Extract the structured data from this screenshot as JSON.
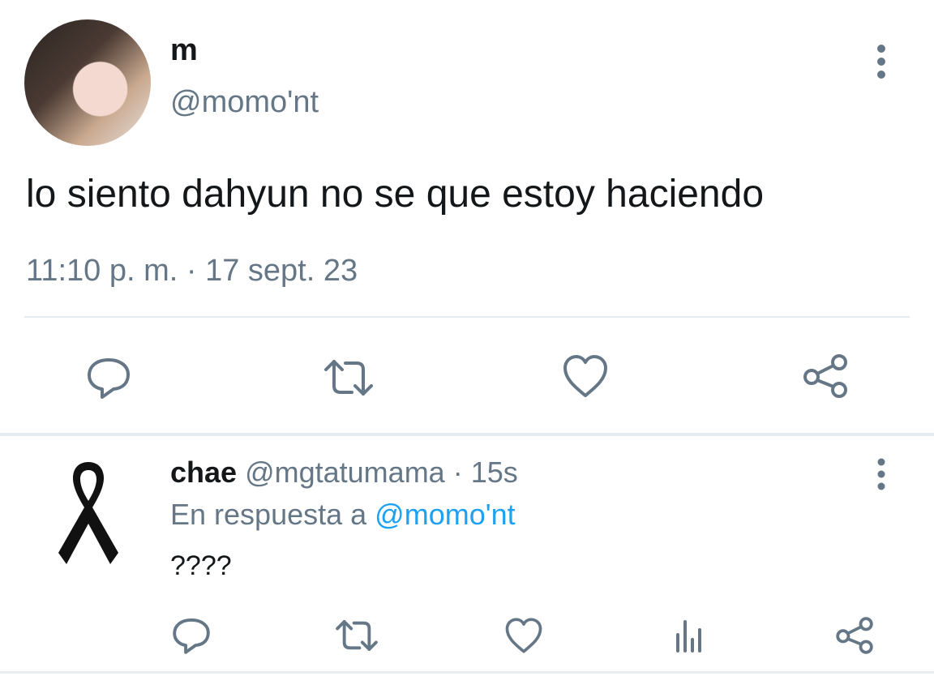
{
  "tweet": {
    "author_name": "m",
    "author_handle": "@momo'nt",
    "text": "lo siento dahyun no se que estoy haciendo",
    "time": "11:10 p. m.",
    "separator": "·",
    "date": "17 sept. 23",
    "actions": [
      "reply-icon",
      "retweet-icon",
      "like-icon",
      "share-icon"
    ]
  },
  "reply": {
    "author_name": "chae",
    "author_handle": "@mgtatumama",
    "separator": "·",
    "time_ago": "15s",
    "reply_prefix": "En respuesta a",
    "reply_to_handle": "@momo'nt",
    "text": "????",
    "actions": [
      "reply-icon",
      "retweet-icon",
      "like-icon",
      "analytics-icon",
      "share-icon"
    ]
  },
  "colors": {
    "text": "#14171a",
    "muted": "#657786",
    "link": "#1da1f2",
    "divider": "#e6ecf0"
  }
}
